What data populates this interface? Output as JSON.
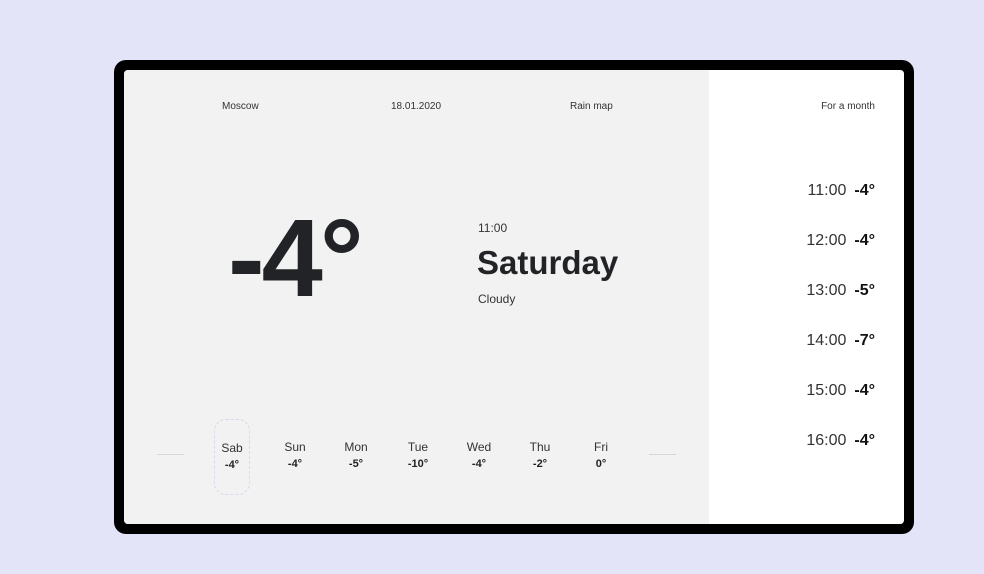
{
  "header": {
    "city": "Moscow",
    "date": "18.01.2020",
    "rain_map": "Rain map",
    "for_month": "For a month"
  },
  "current": {
    "temperature": "-4°",
    "time": "11:00",
    "day": "Saturday",
    "condition": "Cloudy"
  },
  "week": [
    {
      "day": "Sab",
      "temp": "-4°",
      "active": true
    },
    {
      "day": "Sun",
      "temp": "-4°"
    },
    {
      "day": "Mon",
      "temp": "-5°"
    },
    {
      "day": "Tue",
      "temp": "-10°"
    },
    {
      "day": "Wed",
      "temp": "-4°"
    },
    {
      "day": "Thu",
      "temp": "-2°"
    },
    {
      "day": "Fri",
      "temp": "0°"
    }
  ],
  "hourly": [
    {
      "time": "11:00",
      "temp": "-4°"
    },
    {
      "time": "12:00",
      "temp": "-4°"
    },
    {
      "time": "13:00",
      "temp": "-5°"
    },
    {
      "time": "14:00",
      "temp": "-7°"
    },
    {
      "time": "15:00",
      "temp": "-4°"
    },
    {
      "time": "16:00",
      "temp": "-4°"
    }
  ],
  "colors": {
    "background": "#e4e4f8",
    "frame": "#000000",
    "panel": "#f2f2f2",
    "text": "#222327"
  }
}
